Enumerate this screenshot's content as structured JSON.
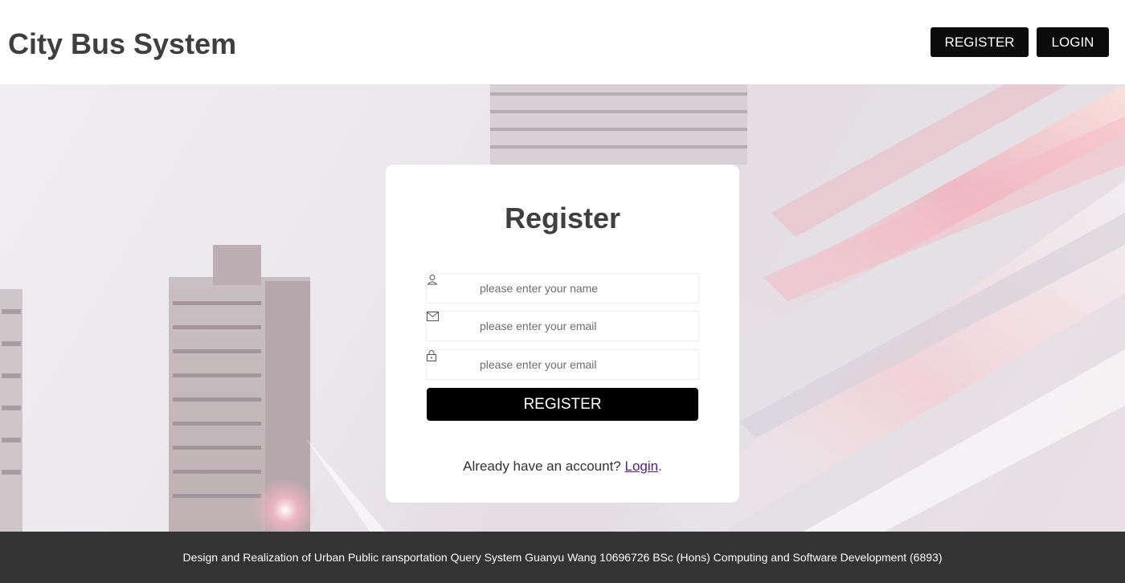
{
  "header": {
    "title": "City Bus System",
    "register_label": "REGISTER",
    "login_label": "LOGIN"
  },
  "register_card": {
    "title": "Register",
    "name_placeholder": "please enter your name",
    "email_placeholder": "please enter your email",
    "password_placeholder": "please enter your email",
    "submit_label": "REGISTER",
    "account_prompt": "Already have an account?",
    "login_link": "Login",
    "period": ".",
    "icons": [
      "user-icon",
      "envelope-icon",
      "lock-icon"
    ]
  },
  "footer": {
    "text": "Design and Realization of Urban Public ransportation Query System Guanyu Wang 10696726 BSc (Hons) Computing and Software Development (6893)"
  },
  "colors": {
    "title_text": "#3f3f3f",
    "button_bg": "#0b0b0b",
    "footer_bg": "#333333",
    "link": "#551a8b"
  }
}
